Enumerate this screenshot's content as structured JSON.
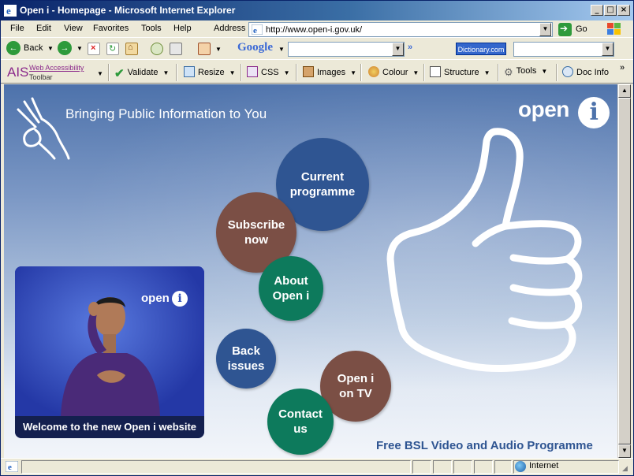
{
  "window": {
    "title": "Open i - Homepage - Microsoft Internet Explorer",
    "controls": {
      "minimize": "_",
      "maximize": "□",
      "close": "×"
    }
  },
  "menu": {
    "items": [
      "File",
      "Edit",
      "View",
      "Favorites",
      "Tools",
      "Help"
    ],
    "address_label": "Address",
    "url": "http://www.open-i.gov.uk/",
    "go_label": "Go"
  },
  "toolbar": {
    "back_label": "Back",
    "google_label": "Google",
    "google_search_value": "",
    "more": "»",
    "dictionary_label": "Dictionary.com",
    "dictionary_search_value": ""
  },
  "ais_toolbar": {
    "logo": "AIS",
    "title_line1": "Web Accessibility",
    "title_line2": "Toolbar",
    "buttons": {
      "validate": "Validate",
      "resize": "Resize",
      "css": "CSS",
      "images": "Images",
      "colour": "Colour",
      "structure": "Structure",
      "tools": "Tools",
      "docinfo": "Doc Info"
    },
    "more": "»"
  },
  "page": {
    "tagline": "Bringing Public Information to You",
    "brand": "open",
    "brand_i": "i",
    "nav": {
      "current_programme": "Current programme",
      "subscribe_now": "Subscribe now",
      "about_open_i": "About Open i",
      "back_issues": "Back issues",
      "open_i_on_tv": "Open i on TV",
      "contact_us": "Contact us"
    },
    "video": {
      "logo": "open",
      "logo_i": "i",
      "caption": "Welcome to the new Open i website"
    },
    "footer": "Free BSL Video and Audio Programme"
  },
  "status": {
    "zone": "Internet"
  },
  "colors": {
    "circle_blue": "#2f5592",
    "circle_brown": "#7b4f45",
    "circle_green": "#0d7a5c",
    "titlebar": "#0a246a"
  }
}
